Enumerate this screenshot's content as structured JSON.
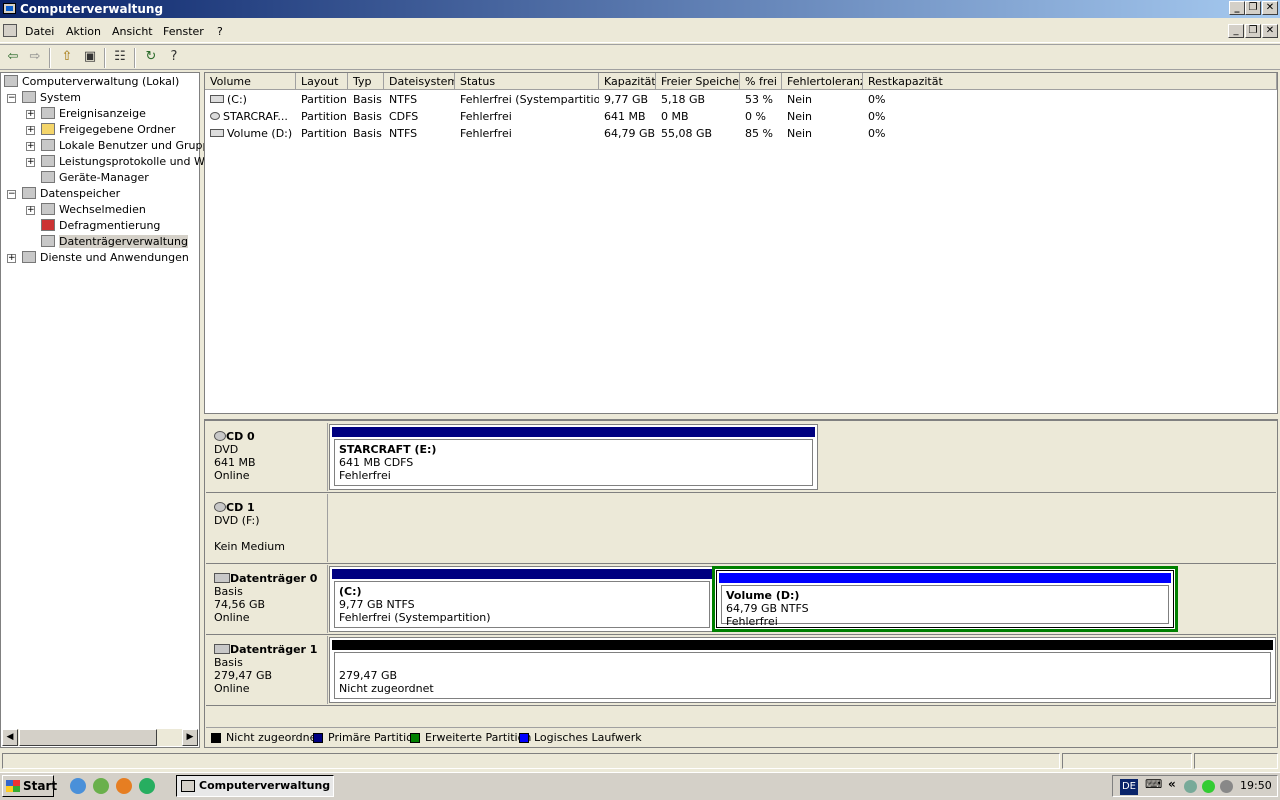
{
  "window": {
    "title": "Computerverwaltung",
    "min": "_",
    "restore": "❐",
    "close": "✕"
  },
  "menu": {
    "items": [
      "Datei",
      "Aktion",
      "Ansicht",
      "Fenster",
      "?"
    ]
  },
  "toolbar": {
    "back": "⇦",
    "forward": "⇨",
    "up": "⇧",
    "show_hide": "▣",
    "properties": "☷",
    "refresh": "↻",
    "help": "?"
  },
  "tree": {
    "root": "Computerverwaltung (Lokal)",
    "system": "System",
    "ereignis": "Ereignisanzeige",
    "freigegeben": "Freigegebene Ordner",
    "lokale": "Lokale Benutzer und Gruppen",
    "leistung": "Leistungsprotokolle und Warnungen",
    "geraete": "Geräte-Manager",
    "datenspeicher": "Datenspeicher",
    "wechsel": "Wechselmedien",
    "defrag": "Defragmentierung",
    "datentraeger": "Datenträgerverwaltung",
    "dienste": "Dienste und Anwendungen",
    "plus": "+",
    "minus": "−"
  },
  "scroll": {
    "left": "◀",
    "right": "▶"
  },
  "volume_table": {
    "columns": [
      "Volume",
      "Layout",
      "Typ",
      "Dateisystem",
      "Status",
      "Kapazität",
      "Freier Speicher",
      "% frei",
      "Fehlertoleranz",
      "Restkapazität"
    ],
    "rows": [
      [
        "(C:)",
        "Partition",
        "Basis",
        "NTFS",
        "Fehlerfrei (Systempartition)",
        "9,77 GB",
        "5,18 GB",
        "53 %",
        "Nein",
        "0%"
      ],
      [
        "STARCRAF...",
        "Partition",
        "Basis",
        "CDFS",
        "Fehlerfrei",
        "641 MB",
        "0 MB",
        "0 %",
        "Nein",
        "0%"
      ],
      [
        "Volume (D:)",
        "Partition",
        "Basis",
        "NTFS",
        "Fehlerfrei",
        "64,79 GB",
        "55,08 GB",
        "85 %",
        "Nein",
        "0%"
      ]
    ]
  },
  "disks": [
    {
      "name": "CD 0",
      "line1": "DVD",
      "line2": "641 MB",
      "line3": "Online"
    },
    {
      "name": "CD 1",
      "line1": "DVD (F:)",
      "line2": "",
      "line3": "Kein Medium"
    },
    {
      "name": "Datenträger 0",
      "line1": "Basis",
      "line2": "74,56 GB",
      "line3": "Online"
    },
    {
      "name": "Datenträger 1",
      "line1": "Basis",
      "line2": "279,47 GB",
      "line3": "Online"
    }
  ],
  "partitions": {
    "starcraft": {
      "title": "STARCRAFT  (E:)",
      "l1": "641 MB CDFS",
      "l2": "Fehlerfrei"
    },
    "c": {
      "title": "(C:)",
      "l1": "9,77 GB NTFS",
      "l2": "Fehlerfrei (Systempartition)"
    },
    "d": {
      "title": "Volume  (D:)",
      "l1": "64,79 GB NTFS",
      "l2": "Fehlerfrei"
    },
    "unalloc": {
      "title": "",
      "l1": "279,47 GB",
      "l2": "Nicht zugeordnet"
    }
  },
  "legend": {
    "items": [
      "Nicht zugeordnet",
      "Primäre Partition",
      "Erweiterte Partition",
      "Logisches Laufwerk"
    ]
  },
  "colors": {
    "primary": "#000080",
    "logical": "#0000ff",
    "extended": "#008000",
    "unallocated": "#000000"
  },
  "taskbar": {
    "start": "Start",
    "task": "Computerverwaltung",
    "lang": "DE",
    "chevron": "«",
    "clock": "19:50"
  }
}
